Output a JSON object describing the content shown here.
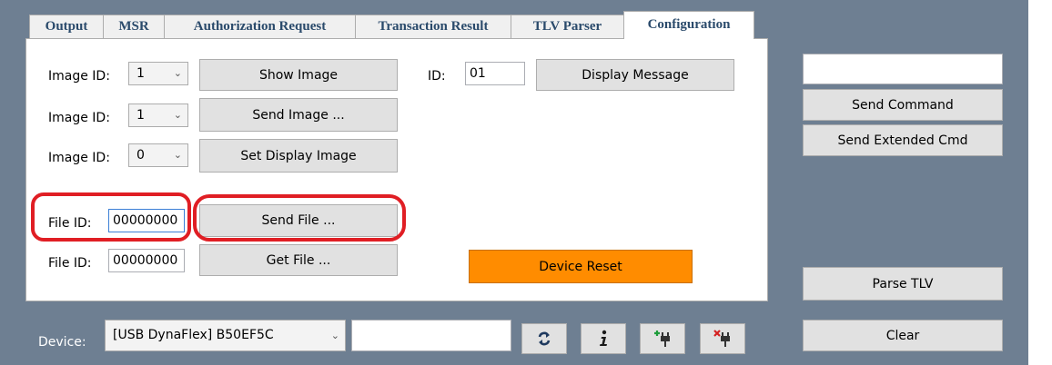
{
  "tabs": [
    {
      "label": "Output"
    },
    {
      "label": "MSR"
    },
    {
      "label": "Authorization Request"
    },
    {
      "label": "Transaction Result"
    },
    {
      "label": "TLV Parser"
    },
    {
      "label": "Configuration"
    }
  ],
  "active_tab": "Configuration",
  "config": {
    "image_rows": [
      {
        "label": "Image ID:",
        "value": "1",
        "button": "Show Image"
      },
      {
        "label": "Image ID:",
        "value": "1",
        "button": "Send Image ..."
      },
      {
        "label": "Image ID:",
        "value": "0",
        "button": "Set Display Image"
      }
    ],
    "message": {
      "label": "ID:",
      "value": "01",
      "button": "Display Message"
    },
    "file_rows": [
      {
        "label": "File ID:",
        "value": "00000000",
        "button": "Send File ..."
      },
      {
        "label": "File ID:",
        "value": "00000000",
        "button": "Get File ..."
      }
    ],
    "reset_button": "Device Reset"
  },
  "right_panel": {
    "command_value": "",
    "send_command": "Send Command",
    "send_extended": "Send Extended Cmd",
    "parse_tlv": "Parse TLV",
    "clear": "Clear"
  },
  "device_bar": {
    "label": "Device:",
    "selected_device": "[USB DynaFlex] B50EF5C",
    "status_value": "",
    "icons": [
      "refresh-icon",
      "info-icon",
      "connect-icon",
      "disconnect-icon"
    ]
  },
  "colors": {
    "window_background": "#6e7f92",
    "reset_button": "#ff8c00",
    "annotation_ring": "#e01e24",
    "tab_text": "#2a4a6b"
  }
}
